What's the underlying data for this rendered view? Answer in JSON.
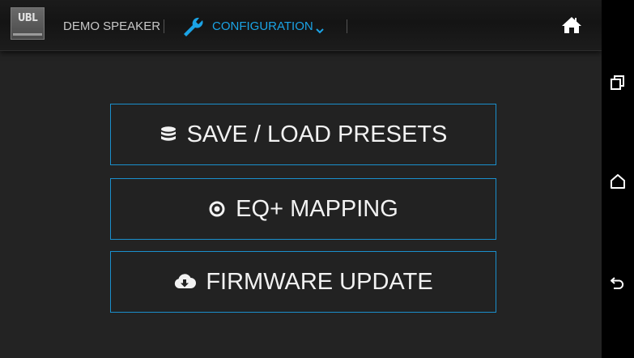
{
  "header": {
    "logo_text": "UBL",
    "device_name": "DEMO SPEAKER",
    "section_label": "CONFIGURATION"
  },
  "menu": {
    "items": [
      {
        "label": "SAVE / LOAD PRESETS",
        "icon": "database-icon"
      },
      {
        "label": "EQ+ MAPPING",
        "icon": "target-icon"
      },
      {
        "label": "FIRMWARE UPDATE",
        "icon": "cloud-download-icon"
      }
    ]
  },
  "android_nav": {
    "buttons": [
      "recents-icon",
      "home-outline-icon",
      "back-icon"
    ]
  },
  "colors": {
    "accent": "#1ba3e5",
    "border": "#1a8fcc",
    "background": "#232323",
    "text": "#f2f2f2"
  }
}
